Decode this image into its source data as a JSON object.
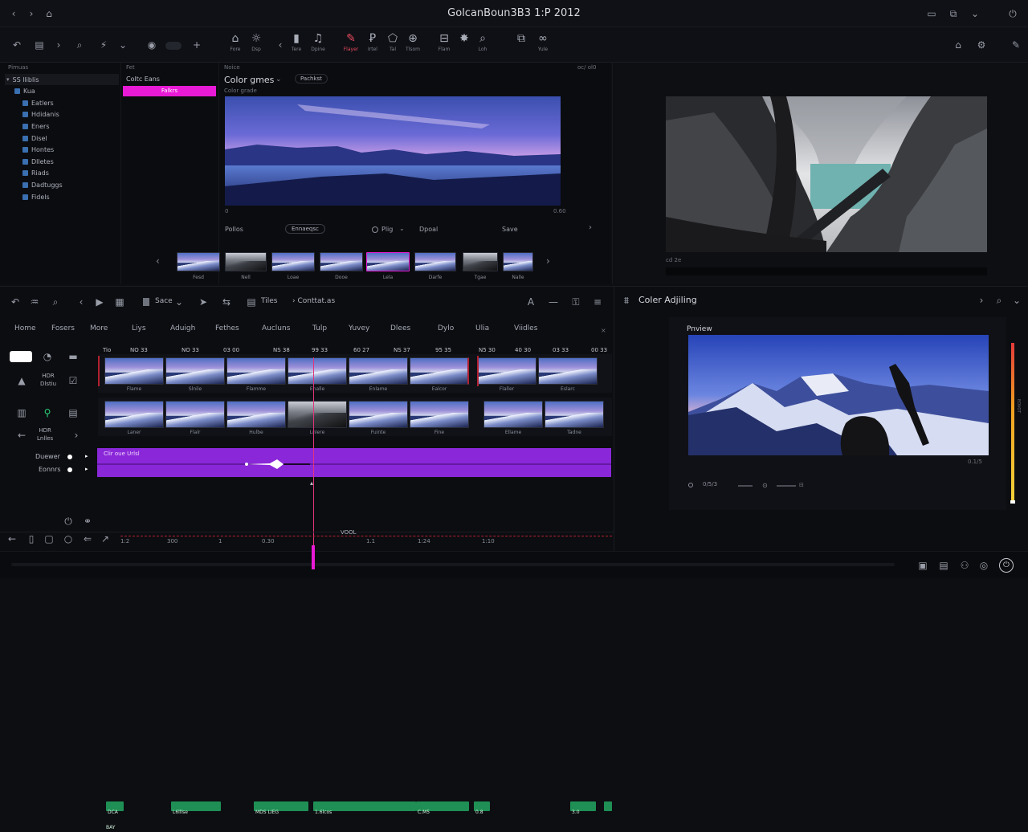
{
  "window": {
    "title": "GolcanBoun3B3 1:P 2012",
    "left_controls": [
      "‹",
      "›",
      "⌂"
    ],
    "right_controls": [
      "▭",
      "⧉",
      "⌄",
      "⏻"
    ]
  },
  "toolbar": {
    "groups": [
      {
        "label": "Fore",
        "icon": "home-icon"
      },
      {
        "label": "Dsp",
        "icon": "sun-icon"
      },
      {
        "label": "Tere",
        "icon": "clip-icon"
      },
      {
        "label": "Dpine",
        "icon": "music-icon"
      },
      {
        "label": "Flayer",
        "icon": "brush-icon",
        "active": true
      },
      {
        "label": "Irtel",
        "icon": "text-icon"
      },
      {
        "label": "Tal",
        "icon": "shape-icon"
      },
      {
        "label": "Tlsom",
        "icon": "globe-icon"
      },
      {
        "label": "Flam",
        "icon": "scissors-icon"
      },
      {
        "label": "",
        "icon": "fx-icon"
      },
      {
        "label": "Loh",
        "icon": "search-icon"
      },
      {
        "label": "",
        "icon": "layers-icon"
      },
      {
        "label": "Yule",
        "icon": "link-icon"
      }
    ]
  },
  "media_browser": {
    "header_left": "Pimuas",
    "header_right": "Fet",
    "tree": [
      {
        "label": "SS lliblis",
        "level": 0,
        "selected": true
      },
      {
        "label": "Kua",
        "level": 1
      },
      {
        "label": "Eatlers",
        "level": 2
      },
      {
        "label": "Hdidanis",
        "level": 2
      },
      {
        "label": "Eners",
        "level": 2
      },
      {
        "label": "Disel",
        "level": 2
      },
      {
        "label": "Hontes",
        "level": 2
      },
      {
        "label": "Dlletes",
        "level": 2
      },
      {
        "label": "Riads",
        "level": 2
      },
      {
        "label": "Dadtuggs",
        "level": 2
      },
      {
        "label": "Fidels",
        "level": 2
      }
    ],
    "bin_header": "Coltc Eans",
    "bin_selected": "Falkrs"
  },
  "color_grade": {
    "panel_label": "Noice",
    "panel_right_label": "oc/ ol0",
    "title": "Color gmes",
    "button": "Pachkst",
    "subtitle": "Color grade",
    "timecode_left": "0",
    "timecode_right": "0.60",
    "controls": {
      "left": "Pollos",
      "pill": "Ennaeqsc",
      "radio_label": "Plig",
      "mid": "Dpoal",
      "right": "Save"
    }
  },
  "filmstrip": {
    "labels": [
      "Fesd",
      "Nell",
      "Loae",
      "Dooe",
      "Lela",
      "Darfe",
      "Tgae",
      "Nalle"
    ]
  },
  "viewer": {
    "label_left": "cd 2e",
    "label_right": ""
  },
  "timeline": {
    "toolbar": {
      "mode": "Sace",
      "tiles": "Tiles",
      "contract": "Conttat.as"
    },
    "menu": [
      "Home",
      "Fosers",
      "More",
      "Liys",
      "Aduigh",
      "Fethes",
      "Aucluns",
      "Tulp",
      "Yuvey",
      "Dlees",
      "Dylo",
      "Ulia",
      "Viidles"
    ],
    "ruler": [
      "NO 33",
      "NO 33",
      "03 00",
      "NS 38",
      "99 33",
      "60 27",
      "NS 37",
      "95 35",
      "N5 30",
      "40 30",
      "03 33",
      "00 33"
    ],
    "ruler_pre": "Tio",
    "left_tools": {
      "hdr": "HDR",
      "hdr_sub": "Dlstiu",
      "hdr2": "HDR",
      "hdr2_sub": "Lnlles"
    },
    "video_track1_labels": [
      "Flame",
      "Slnile",
      "Flamme",
      "Enalle",
      "Enlame",
      "Ealcor",
      "Flaller",
      "Eslarc",
      "Fasler"
    ],
    "video_track2_labels": [
      "Laner",
      "Flalr",
      "Hulbe",
      "Lnlere",
      "Fuinte",
      "Fine",
      "Ellame",
      "Tadne"
    ],
    "audio_track": {
      "title": "Clir oue Urlsl",
      "labels": [
        "Duewer",
        "Eonnrs"
      ]
    },
    "bottom_ruler": [
      "1:2",
      "300",
      "1",
      "0.30",
      "1.1",
      "1:24",
      "1:10"
    ],
    "bottom_ruler_center": "VOOL",
    "green_labels": [
      "DCA BAY",
      "L6lllse",
      "MDS LIEG",
      "1.6lcos",
      "C.M5",
      "0.8",
      "3.0"
    ],
    "playhead": "#e2337d"
  },
  "color_adjusting": {
    "title": "Coler Adjiling",
    "preview_label": "Pnview",
    "meter_label": "EOVOT",
    "timecode": "0.1/5",
    "controls_text": "0/5/3"
  },
  "colors": {
    "accent_magenta": "#e81ad6",
    "accent_purple": "#8a27d8",
    "accent_green": "#1f8f55",
    "clip_red": "#b2202f",
    "bg": "#0d0e12"
  }
}
